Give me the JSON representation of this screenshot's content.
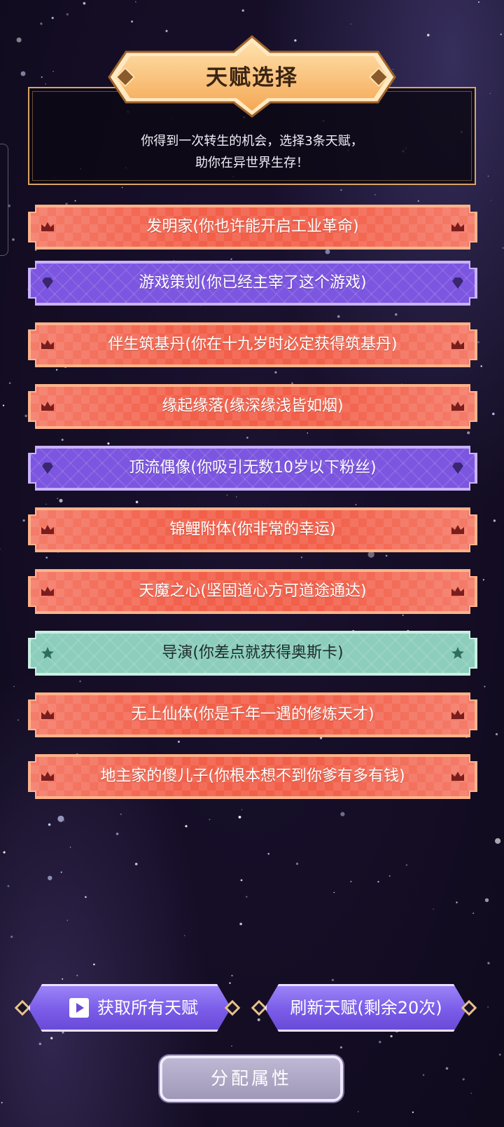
{
  "header": {
    "title": "天赋选择",
    "intro_line1": "你得到一次转生的机会，选择3条天赋，",
    "intro_line2": "助你在异世界生存！"
  },
  "talents": [
    {
      "label": "发明家(你也许能开启工业革命)",
      "rarity": "orange",
      "icon": "crown-icon"
    },
    {
      "label": "游戏策划(你已经主宰了这个游戏)",
      "rarity": "purple",
      "icon": "gem-icon"
    },
    {
      "label": "伴生筑基丹(你在十九岁时必定获得筑基丹)",
      "rarity": "orange",
      "icon": "crown-icon"
    },
    {
      "label": "缘起缘落(缘深缘浅皆如烟)",
      "rarity": "orange",
      "icon": "crown-icon"
    },
    {
      "label": "顶流偶像(你吸引无数10岁以下粉丝)",
      "rarity": "purple",
      "icon": "gem-icon"
    },
    {
      "label": "锦鲤附体(你非常的幸运)",
      "rarity": "orange",
      "icon": "crown-icon"
    },
    {
      "label": "天魔之心(坚固道心方可道途通达)",
      "rarity": "orange",
      "icon": "crown-icon"
    },
    {
      "label": "导演(你差点就获得奥斯卡)",
      "rarity": "teal",
      "icon": "star-icon"
    },
    {
      "label": "无上仙体(你是千年一遇的修炼天才)",
      "rarity": "orange",
      "icon": "crown-icon"
    },
    {
      "label": "地主家的傻儿子(你根本想不到你爹有多有钱)",
      "rarity": "orange",
      "icon": "crown-icon"
    }
  ],
  "buttons": {
    "get_all": "获取所有天赋",
    "refresh": "刷新天赋(剩余20次)",
    "assign": "分配属性"
  },
  "colors": {
    "orange": "#f2604a",
    "purple": "#7c55e0",
    "teal": "#8ccdbb",
    "gold": "#d9a463"
  }
}
